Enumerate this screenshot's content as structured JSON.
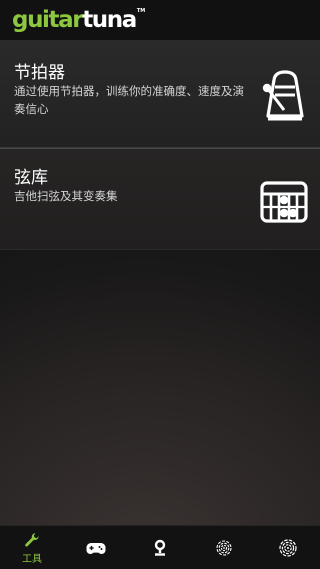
{
  "header": {
    "logo_part1": "guitar",
    "logo_part2": "tuna",
    "logo_tm": "TM"
  },
  "tools": [
    {
      "title": "节拍器",
      "description": "通过使用节拍器，训练你的准确度、速度及演奏信心",
      "icon": "metronome-icon"
    },
    {
      "title": "弦库",
      "description": "吉他扫弦及其变奏集",
      "icon": "chord-diagram-icon"
    }
  ],
  "tabbar": {
    "active_index": 0,
    "items": [
      {
        "icon": "wrench-icon",
        "label": "工具"
      },
      {
        "icon": "gamepad-icon",
        "label": ""
      },
      {
        "icon": "tuner-pin-icon",
        "label": ""
      },
      {
        "icon": "fingerprint-icon",
        "label": ""
      },
      {
        "icon": "fingerprint-icon",
        "label": ""
      }
    ]
  },
  "colors": {
    "accent": "#8dc63f",
    "header_bg": "#111111",
    "text_primary": "#ffffff",
    "text_secondary": "#d4d4d4"
  }
}
